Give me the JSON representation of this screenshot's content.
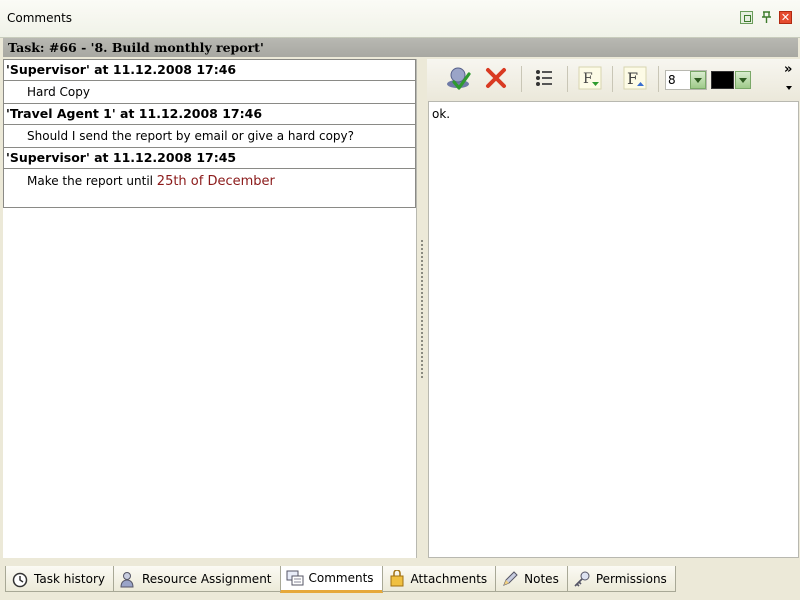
{
  "panel": {
    "title": "Comments"
  },
  "task": {
    "header": "Task: #66 - '8. Build monthly report'"
  },
  "comments": [
    {
      "header": "'Supervisor' at 11.12.2008 17:46",
      "body": "Hard Copy"
    },
    {
      "header": "'Travel Agent 1' at 11.12.2008 17:46",
      "body": "Should I send the report by email or give a hard copy?"
    },
    {
      "header": "'Supervisor' at 11.12.2008 17:45",
      "body_prefix": "Make the report until ",
      "body_highlight": "25th of December"
    }
  ],
  "editor": {
    "font_size": "8",
    "text": "ok.",
    "overflow": "»"
  },
  "tabs": [
    {
      "label": "Task history",
      "icon": "clock-icon"
    },
    {
      "label": "Resource Assignment",
      "icon": "person-icon"
    },
    {
      "label": "Comments",
      "icon": "comments-icon",
      "active": true
    },
    {
      "label": "Attachments",
      "icon": "paperclip-icon"
    },
    {
      "label": "Notes",
      "icon": "pencil-icon"
    },
    {
      "label": "Permissions",
      "icon": "key-icon"
    }
  ],
  "colors": {
    "highlight": "#8b1a1a",
    "active_tab_accent": "#e6a83a",
    "text_color": "#000000"
  }
}
